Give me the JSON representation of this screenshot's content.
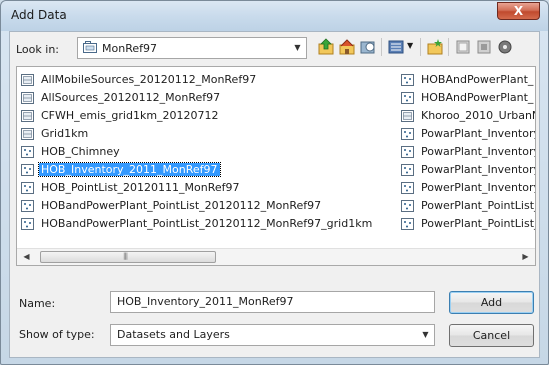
{
  "window": {
    "title": "Add Data",
    "close_label": "X"
  },
  "lookin": {
    "label": "Look in:",
    "value": "MonRef97"
  },
  "toolbar": {
    "icons": [
      "up-folder-icon",
      "home-icon",
      "catalog-icon",
      "view-list-icon",
      "new-folder-icon",
      "disconnect-icon",
      "connect-icon",
      "options-icon"
    ]
  },
  "files": {
    "column1": [
      {
        "name": "AllMobileSources_20120112_MonRef97",
        "type": "table"
      },
      {
        "name": "AllSources_20120112_MonRef97",
        "type": "table"
      },
      {
        "name": "CFWH_emis_grid1km_20120712",
        "type": "table"
      },
      {
        "name": "Grid1km",
        "type": "table"
      },
      {
        "name": "HOB_Chimney",
        "type": "point"
      },
      {
        "name": "HOB_Inventory_2011_MonRef97",
        "type": "point",
        "selected": true
      },
      {
        "name": "HOB_PointList_20120111_MonRef97",
        "type": "point"
      },
      {
        "name": "HOBandPowerPlant_PointList_20120112_MonRef97",
        "type": "point"
      },
      {
        "name": "HOBandPowerPlant_PointList_20120112_MonRef97_grid1km",
        "type": "point"
      }
    ],
    "column2": [
      {
        "name": "HOBAndPowerPlant_",
        "type": "point"
      },
      {
        "name": "HOBAndPowerPlant_",
        "type": "point"
      },
      {
        "name": "Khoroo_2010_UrbanN",
        "type": "table"
      },
      {
        "name": "PowarPlant_Inventory",
        "type": "point"
      },
      {
        "name": "PowarPlant_Inventory",
        "type": "point"
      },
      {
        "name": "PowarPlant_Inventory",
        "type": "point"
      },
      {
        "name": "PowerPlant_Inventory",
        "type": "point"
      },
      {
        "name": "PowerPlant_PointList_",
        "type": "point"
      },
      {
        "name": "PowerPlant_PointList_",
        "type": "point"
      }
    ]
  },
  "name_field": {
    "label": "Name:",
    "value": "HOB_Inventory_2011_MonRef97"
  },
  "show_type": {
    "label": "Show of type:",
    "value": "Datasets and Layers"
  },
  "buttons": {
    "add": "Add",
    "cancel": "Cancel"
  }
}
